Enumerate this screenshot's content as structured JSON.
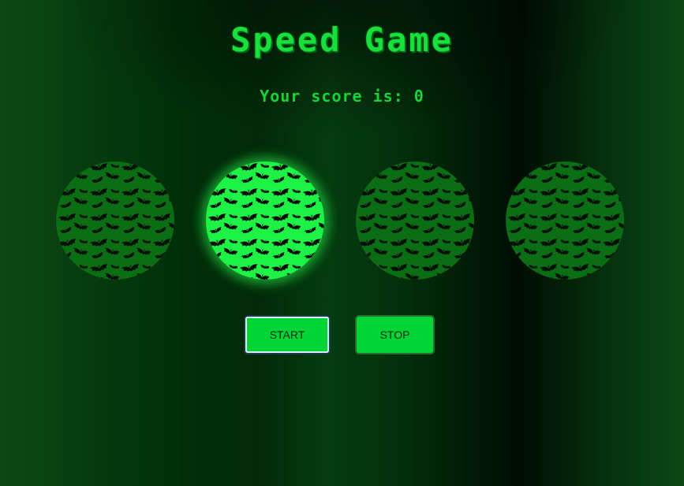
{
  "game": {
    "title": "Speed Game",
    "score_label": "Your score is: ",
    "score_value": "0",
    "active_circle_index": 1,
    "circle_count": 4,
    "circle_pattern": "bat-icon"
  },
  "controls": {
    "start_label": "START",
    "stop_label": "STOP"
  },
  "colors": {
    "accent": "#17e03c",
    "circle_idle": "#0b6e14",
    "circle_active": "#1ff247",
    "button": "#00d437"
  }
}
